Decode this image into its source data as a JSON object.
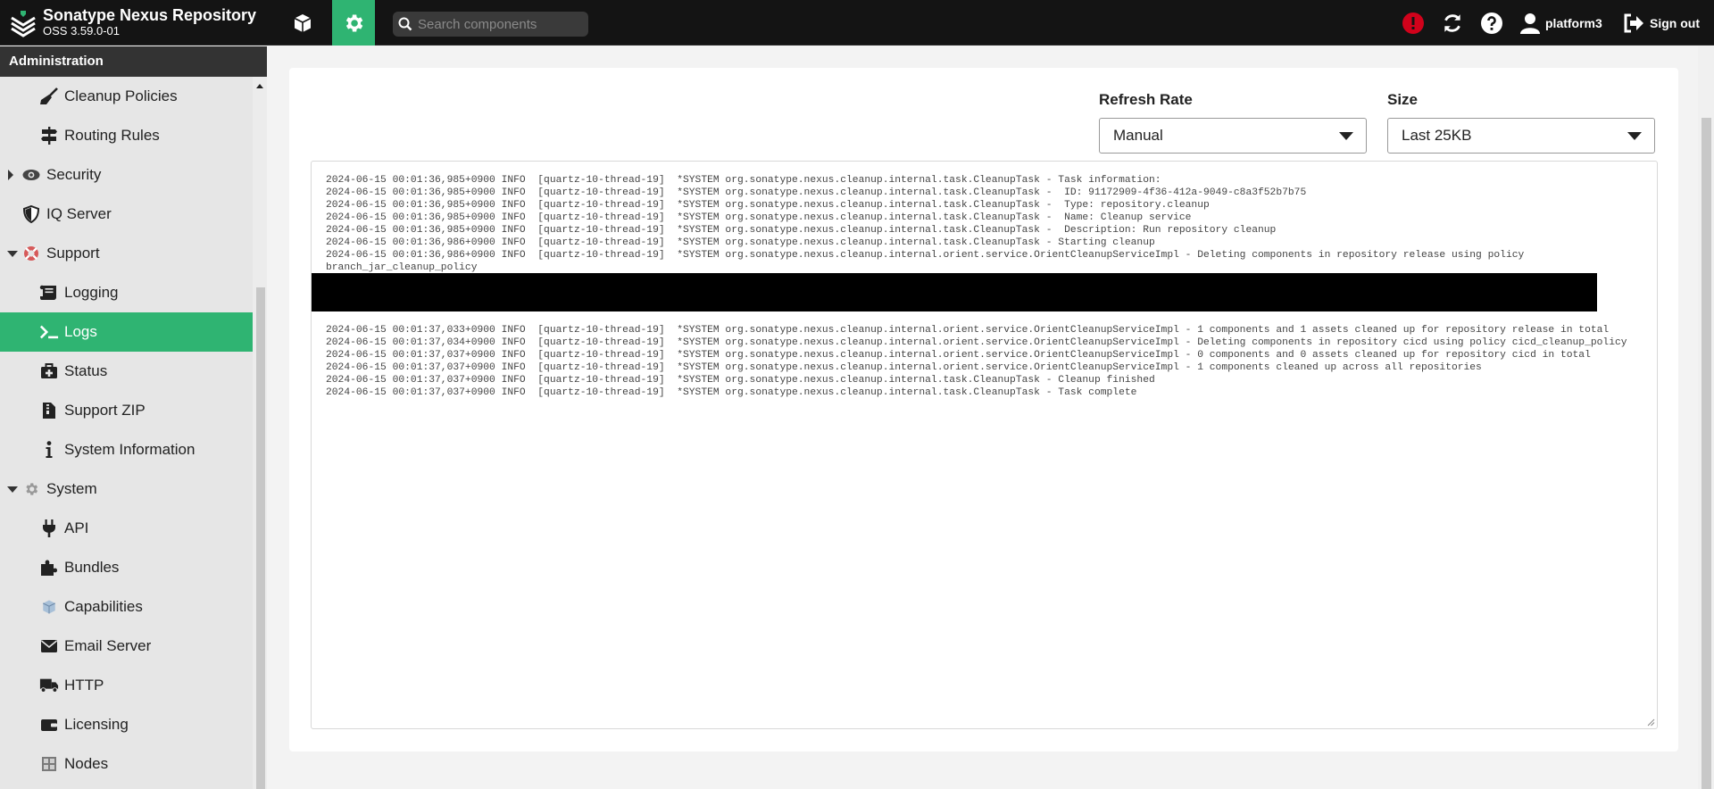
{
  "header": {
    "app_name": "Sonatype Nexus Repository",
    "version": "OSS 3.59.0-01",
    "search_placeholder": "Search components",
    "username": "platform3",
    "sign_out_label": "Sign out"
  },
  "sidebar": {
    "title": "Administration",
    "items": [
      {
        "label": "Cleanup Policies",
        "level": 1,
        "icon": "broom-icon"
      },
      {
        "label": "Routing Rules",
        "level": 1,
        "icon": "signpost-icon"
      },
      {
        "label": "Security",
        "level": 0,
        "icon": "eye-icon",
        "expanded": false
      },
      {
        "label": "IQ Server",
        "level": 0,
        "icon": "shield-icon"
      },
      {
        "label": "Support",
        "level": 0,
        "icon": "lifebuoy-icon",
        "expanded": true
      },
      {
        "label": "Logging",
        "level": 1,
        "icon": "scroll-icon"
      },
      {
        "label": "Logs",
        "level": 1,
        "icon": "terminal-icon",
        "active": true
      },
      {
        "label": "Status",
        "level": 1,
        "icon": "medkit-icon"
      },
      {
        "label": "Support ZIP",
        "level": 1,
        "icon": "file-zip-icon"
      },
      {
        "label": "System Information",
        "level": 1,
        "icon": "info-icon"
      },
      {
        "label": "System",
        "level": 0,
        "icon": "cog-icon",
        "expanded": true
      },
      {
        "label": "API",
        "level": 1,
        "icon": "plug-icon"
      },
      {
        "label": "Bundles",
        "level": 1,
        "icon": "puzzle-icon"
      },
      {
        "label": "Capabilities",
        "level": 1,
        "icon": "cube-icon"
      },
      {
        "label": "Email Server",
        "level": 1,
        "icon": "envelope-icon"
      },
      {
        "label": "HTTP",
        "level": 1,
        "icon": "truck-icon"
      },
      {
        "label": "Licensing",
        "level": 1,
        "icon": "wallet-icon"
      },
      {
        "label": "Nodes",
        "level": 1,
        "icon": "server-icon"
      }
    ]
  },
  "logs": {
    "refresh_rate_label": "Refresh Rate",
    "refresh_rate_value": "Manual",
    "size_label": "Size",
    "size_value": "Last 25KB",
    "lines": [
      "2024-06-15 00:01:36,985+0900 INFO  [quartz-10-thread-19]  *SYSTEM org.sonatype.nexus.cleanup.internal.task.CleanupTask - Task information:",
      "2024-06-15 00:01:36,985+0900 INFO  [quartz-10-thread-19]  *SYSTEM org.sonatype.nexus.cleanup.internal.task.CleanupTask -  ID: 91172909-4f36-412a-9049-c8a3f52b7b75",
      "2024-06-15 00:01:36,985+0900 INFO  [quartz-10-thread-19]  *SYSTEM org.sonatype.nexus.cleanup.internal.task.CleanupTask -  Type: repository.cleanup",
      "2024-06-15 00:01:36,985+0900 INFO  [quartz-10-thread-19]  *SYSTEM org.sonatype.nexus.cleanup.internal.task.CleanupTask -  Name: Cleanup service",
      "2024-06-15 00:01:36,985+0900 INFO  [quartz-10-thread-19]  *SYSTEM org.sonatype.nexus.cleanup.internal.task.CleanupTask -  Description: Run repository cleanup",
      "2024-06-15 00:01:36,986+0900 INFO  [quartz-10-thread-19]  *SYSTEM org.sonatype.nexus.cleanup.internal.task.CleanupTask - Starting cleanup",
      "2024-06-15 00:01:36,986+0900 INFO  [quartz-10-thread-19]  *SYSTEM org.sonatype.nexus.cleanup.internal.orient.service.OrientCleanupServiceImpl - Deleting components in repository release using policy branch_jar_cleanup_policy"
    ],
    "lines_after": [
      "2024-06-15 00:01:37,033+0900 INFO  [quartz-10-thread-19]  *SYSTEM org.sonatype.nexus.cleanup.internal.orient.service.OrientCleanupServiceImpl - 1 components and 1 assets cleaned up for repository release in total",
      "2024-06-15 00:01:37,034+0900 INFO  [quartz-10-thread-19]  *SYSTEM org.sonatype.nexus.cleanup.internal.orient.service.OrientCleanupServiceImpl - Deleting components in repository cicd using policy cicd_cleanup_policy",
      "2024-06-15 00:01:37,037+0900 INFO  [quartz-10-thread-19]  *SYSTEM org.sonatype.nexus.cleanup.internal.orient.service.OrientCleanupServiceImpl - 0 components and 0 assets cleaned up for repository cicd in total",
      "2024-06-15 00:01:37,037+0900 INFO  [quartz-10-thread-19]  *SYSTEM org.sonatype.nexus.cleanup.internal.orient.service.OrientCleanupServiceImpl - 1 components cleaned up across all repositories",
      "2024-06-15 00:01:37,037+0900 INFO  [quartz-10-thread-19]  *SYSTEM org.sonatype.nexus.cleanup.internal.task.CleanupTask - Cleanup finished",
      "2024-06-15 00:01:37,037+0900 INFO  [quartz-10-thread-19]  *SYSTEM org.sonatype.nexus.cleanup.internal.task.CleanupTask - Task complete"
    ]
  },
  "colors": {
    "header_bg": "#141414",
    "accent_green": "#2fb472",
    "alert_red": "#d0021b"
  }
}
